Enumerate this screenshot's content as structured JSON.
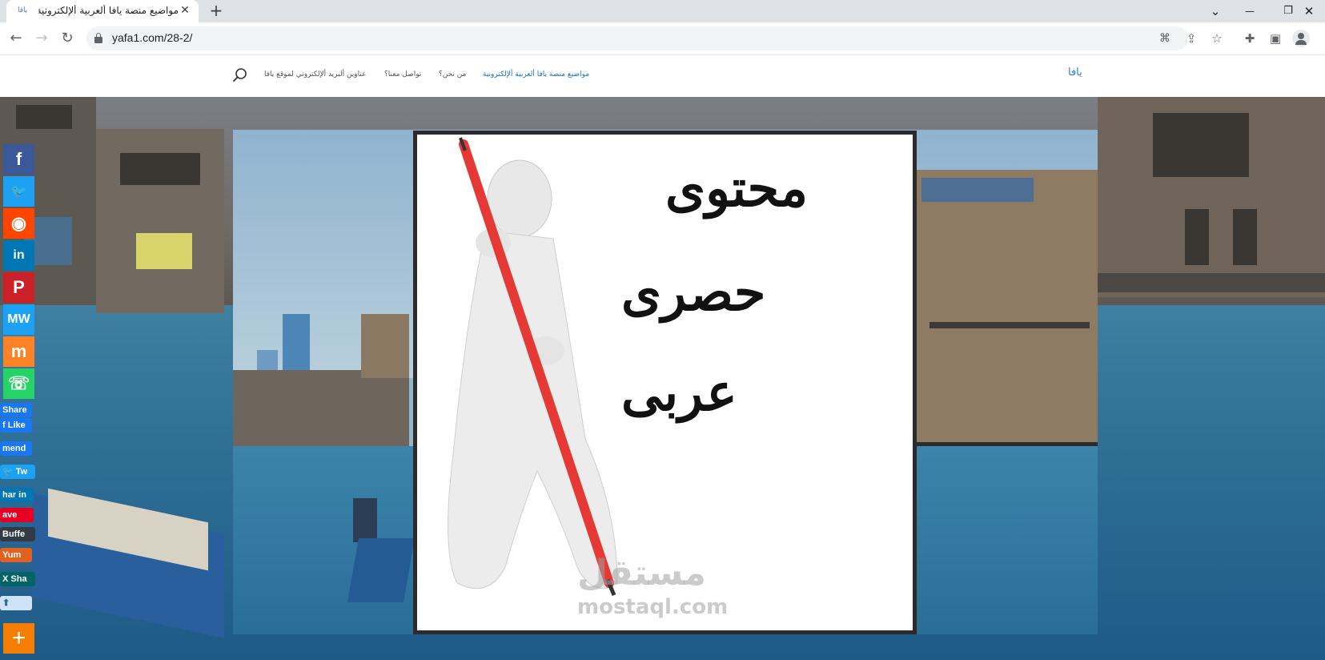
{
  "browser": {
    "tab_favicon": "يافا",
    "tab_title": "مواضيع منصة يافا ألعربية ألإلكترونية",
    "tab_close": "✕",
    "new_tab": "+",
    "url": "yafa1.com/28-2/",
    "win_controls": [
      "⌄",
      "—",
      "❐",
      "✕"
    ]
  },
  "site": {
    "logo": "يافا",
    "nav": [
      {
        "label": "مواضيع منصة يافا ألعربية ألإلكترونية",
        "active": true
      },
      {
        "label": "من نحن؟",
        "active": false
      },
      {
        "label": "تواصل معنا؟",
        "active": false
      },
      {
        "label": "عناوين ألبريد ألإلكتروني لموقع يافا",
        "active": false
      }
    ]
  },
  "card": {
    "words": [
      "محتوى",
      "حصرى",
      "عربى"
    ]
  },
  "watermark": {
    "arabic": "مستقل",
    "latin": "mostaql.com"
  },
  "share": {
    "buttons": [
      {
        "name": "facebook",
        "label": "f",
        "color": "#3b5998"
      },
      {
        "name": "twitter",
        "label": "🐦",
        "color": "#1da1f2"
      },
      {
        "name": "reddit",
        "label": "◉",
        "color": "#ff4500"
      },
      {
        "name": "linkedin",
        "label": "in",
        "color": "#0077b5"
      },
      {
        "name": "pinterest",
        "label": "P",
        "color": "#cb2027"
      },
      {
        "name": "mewe",
        "label": "MW",
        "color": "#1da1f2"
      },
      {
        "name": "mix",
        "label": "m",
        "color": "#ff8226"
      },
      {
        "name": "whatsapp",
        "label": "☏",
        "color": "#25d366"
      }
    ],
    "mini": [
      {
        "name": "fb-share",
        "label": "Share",
        "color": "#1877f2"
      },
      {
        "name": "fb-like",
        "label": "f Like",
        "color": "#1877f2"
      },
      {
        "name": "recommend",
        "label": "mend",
        "color": "#1877f2"
      },
      {
        "name": "tweet",
        "label": "🐦 Tw",
        "color": "#1da1f2"
      },
      {
        "name": "linkedin-share",
        "label": "har in",
        "color": "#0077b5"
      },
      {
        "name": "pinterest-save",
        "label": "ave",
        "color": "#e60023"
      },
      {
        "name": "buffer",
        "label": "Buffe",
        "color": "#323b43"
      },
      {
        "name": "yummly",
        "label": "Yum",
        "color": "#e16120"
      },
      {
        "name": "xing-share",
        "label": "X Sha",
        "color": "#026466"
      },
      {
        "name": "reddit-vote",
        "label": "⬆",
        "color": "#cee3f8"
      }
    ],
    "more_label": "+"
  }
}
